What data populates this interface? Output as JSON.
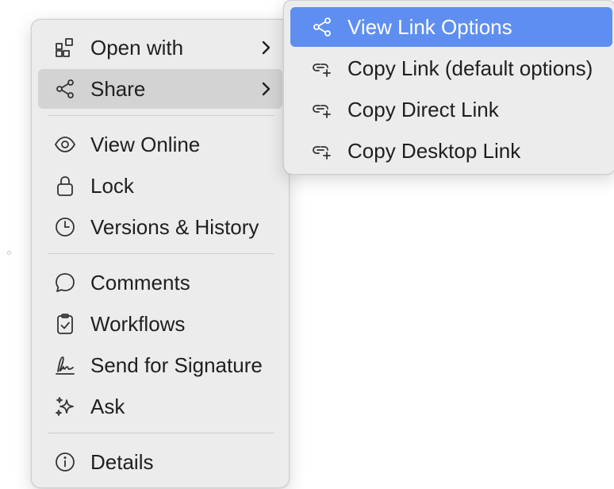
{
  "main_menu": {
    "items": [
      {
        "label": "Open with",
        "icon": "open-with-icon"
      },
      {
        "label": "Share",
        "icon": "share-icon"
      },
      {
        "label": "View Online",
        "icon": "eye-icon"
      },
      {
        "label": "Lock",
        "icon": "lock-icon"
      },
      {
        "label": "Versions & History",
        "icon": "clock-icon"
      },
      {
        "label": "Comments",
        "icon": "comment-icon"
      },
      {
        "label": "Workflows",
        "icon": "clipboard-check-icon"
      },
      {
        "label": "Send for Signature",
        "icon": "signature-icon"
      },
      {
        "label": "Ask",
        "icon": "sparkle-icon"
      },
      {
        "label": "Details",
        "icon": "info-icon"
      }
    ]
  },
  "submenu": {
    "items": [
      {
        "label": "View Link Options",
        "icon": "share-icon"
      },
      {
        "label": "Copy Link (default options)",
        "icon": "link-add-icon"
      },
      {
        "label": "Copy Direct Link",
        "icon": "link-add-icon"
      },
      {
        "label": "Copy Desktop Link",
        "icon": "link-add-icon"
      }
    ]
  },
  "colors": {
    "menu_background": "#ececec",
    "hover_background": "#d3d3d3",
    "selected_background": "#5e8ff0",
    "text": "#1f1f1f"
  }
}
